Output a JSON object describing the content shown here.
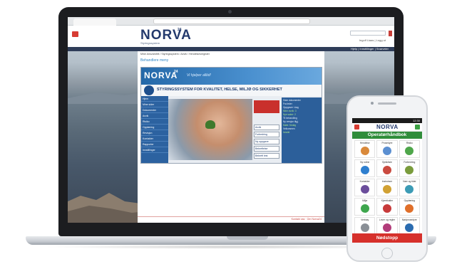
{
  "site": {
    "logo": "NORVA",
    "logo_sup": "24",
    "logo_sub": "Styringssystem",
    "user_links": "Ingolf Liaas | Logg ut",
    "nav_links": "Hjelp | Innstillinger | Snarveier",
    "breadcrumb": "Mine Ansvarsfelt / Styringssystem / Avvik / Hendelsesregister",
    "page_heading": "Behandlere meny",
    "footer": "Kontakt oss · Om Norva24"
  },
  "embed": {
    "logo": "NORVA",
    "logo_sup": "24",
    "tagline": "Vi hjelper alltid!",
    "banner": "STYRINGSSYSTEM FOR KVALITET, HELSE, MILJØ OG SIKKERHET",
    "side_items": [
      "Hjem",
      "Mine sider",
      "Dokumenter",
      "Avvik",
      "Risiko",
      "Opplæring",
      "Revisjon",
      "Kontakter",
      "Rapporter",
      "Innstillinger"
    ],
    "buttons": [
      "Avvik",
      "Forbedring",
      "Ny oppgave",
      "Bekreftelse",
      "Bekreft lest"
    ],
    "info": [
      "Siste dokumenter",
      "Fra leder",
      "Oppgaver i dag",
      "Mine avvik: 3",
      "Nye saker: 2",
      "Til behandling",
      "Ny versjon tilgj.",
      "Møte: fredag",
      "Velkommen",
      "Innsikt"
    ]
  },
  "phone": {
    "status": "12:30",
    "logo": "NORVA",
    "title": "Operatørhåndbok",
    "tiles": [
      {
        "label": "Hendelse",
        "color": "#d9893a"
      },
      {
        "label": "Prosedyre",
        "color": "#5b8fd1"
      },
      {
        "label": "Risiko",
        "color": "#4ea64a"
      },
      {
        "label": "Ny rutine",
        "color": "#2e7fcf"
      },
      {
        "label": "Sjekkliste",
        "color": "#ca4a3f"
      },
      {
        "label": "Forbedring",
        "color": "#7a9c3c"
      },
      {
        "label": "Kontakter",
        "color": "#6b4d9b"
      },
      {
        "label": "Instrukser",
        "color": "#d1a133"
      },
      {
        "label": "Vaer og tider",
        "color": "#3c9bb5"
      },
      {
        "label": "Miljø",
        "color": "#3ea64d"
      },
      {
        "label": "Kjemikalier",
        "color": "#c73a3a"
      },
      {
        "label": "Opplæring",
        "color": "#e06f2a"
      },
      {
        "label": "Verktøy",
        "color": "#8a8f96"
      },
      {
        "label": "Lover og regler",
        "color": "#b23c7a"
      },
      {
        "label": "Nødprosedyre",
        "color": "#2b6cb0"
      }
    ],
    "footer": "Nødstopp"
  }
}
